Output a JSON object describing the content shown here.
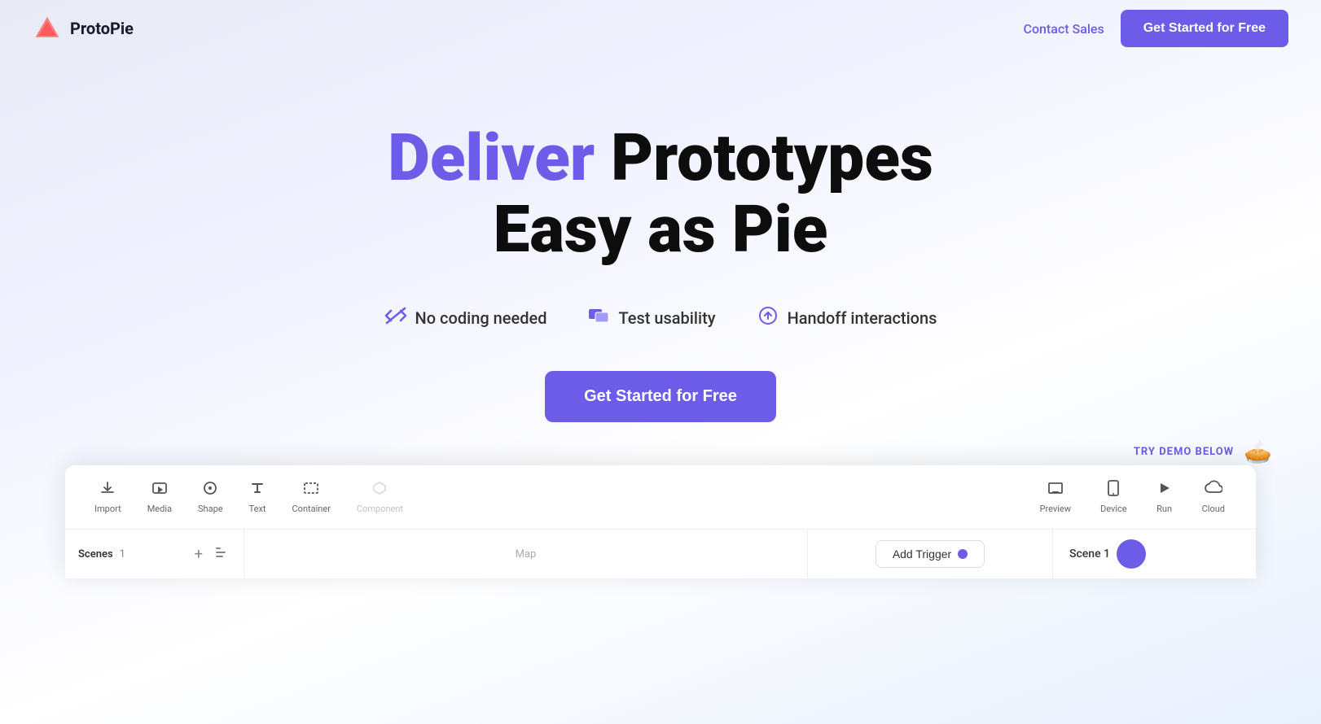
{
  "navbar": {
    "logo_text": "ProtoPie",
    "contact_sales_label": "Contact Sales",
    "get_started_nav_label": "Get Started for Free"
  },
  "hero": {
    "title_part1": "Deliver",
    "title_part2": "Prototypes",
    "title_part3": "Easy as Pie",
    "feature1_label": "No coding needed",
    "feature2_label": "Test usability",
    "feature3_label": "Handoff interactions",
    "cta_label": "Get Started for Free"
  },
  "try_demo": {
    "label": "TRY DEMO BELOW",
    "emoji": "🥧"
  },
  "toolbar": {
    "import_label": "Import",
    "media_label": "Media",
    "shape_label": "Shape",
    "text_label": "Text",
    "container_label": "Container",
    "component_label": "Component",
    "preview_label": "Preview",
    "device_label": "Device",
    "run_label": "Run",
    "cloud_label": "Cloud"
  },
  "bottom": {
    "scenes_label": "Scenes",
    "scenes_count": "1",
    "canvas_label": "Map",
    "add_trigger_label": "Add Trigger",
    "scene_name_label": "Scene 1"
  },
  "colors": {
    "accent": "#6c5ce7",
    "text_dark": "#0d0d0d",
    "text_medium": "#333333",
    "text_light": "#888888"
  }
}
